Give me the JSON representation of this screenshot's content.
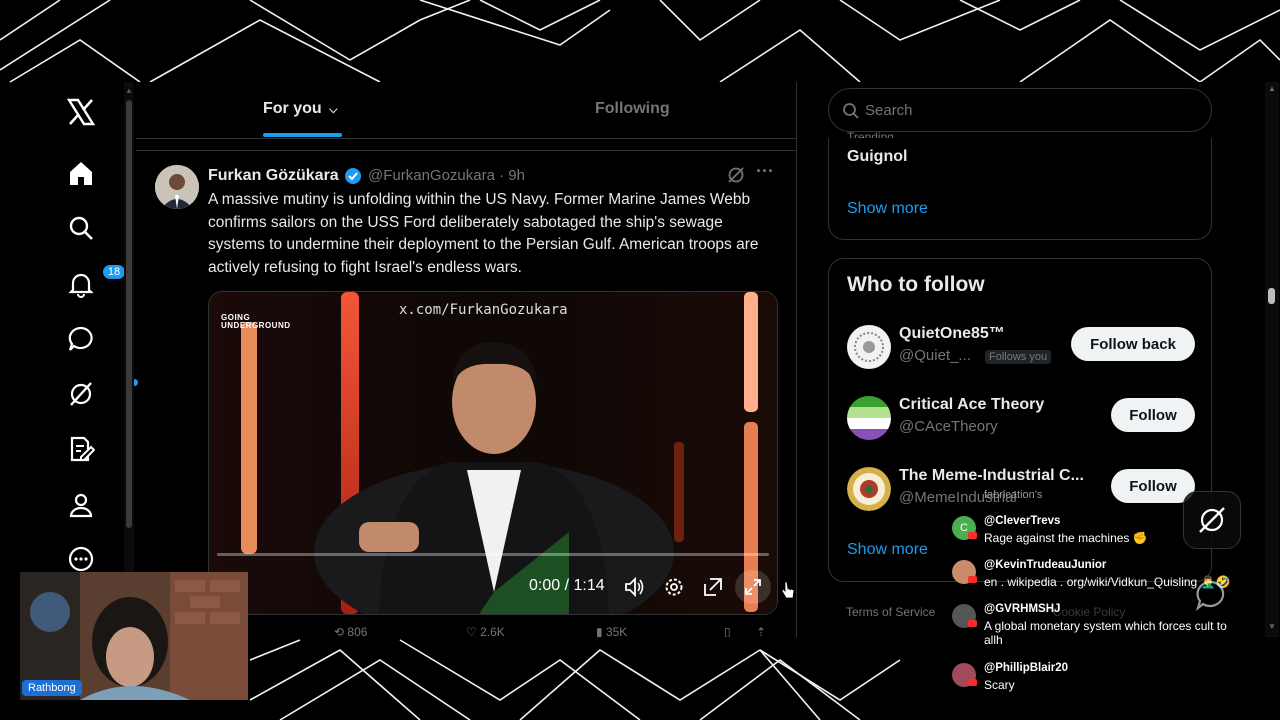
{
  "nav": {
    "notifications_count": "18",
    "icons": [
      "x-logo-icon",
      "home-icon",
      "search-icon",
      "bell-icon",
      "chat-icon",
      "grok-icon",
      "compose-icon",
      "profile-icon",
      "more-icon"
    ]
  },
  "feed": {
    "tabs": [
      {
        "label": "For you",
        "active": true
      },
      {
        "label": "Following",
        "active": false
      }
    ],
    "tweet": {
      "author": "Furkan Gözükara",
      "handle": "@FurkanGozukara · 9h",
      "text": "A massive mutiny is unfolding within the US Navy. Former Marine James Webb confirms sailors on the USS Ford deliberately sabotaged the ship's sewage systems to undermine their deployment to the Persian Gulf. American troops are actively refusing to fight Israel's endless wars.",
      "video": {
        "watermark": "x.com/FurkanGozukara",
        "show_logo_line1": "GOING",
        "show_logo_line2": "UNDERGROUND",
        "time": "0:00 / 1:14",
        "progress": 0
      },
      "stats": {
        "retweets": "806",
        "likes": "2.6K",
        "views": "35K"
      }
    }
  },
  "right": {
    "search_placeholder": "Search",
    "trend": {
      "label": "Trending",
      "title": "Guignol"
    },
    "show_more": "Show more",
    "who_to_follow": {
      "title": "Who to follow",
      "users": [
        {
          "name": "QuietOne85™",
          "handle": "@Quiet_...",
          "badge": "Follows you",
          "button": "Follow back"
        },
        {
          "name": "Critical Ace Theory",
          "handle": "@CAceTheory",
          "button": "Follow"
        },
        {
          "name": "The Meme-Industrial C...",
          "handle": "@MemeIndustrial",
          "button": "Follow"
        }
      ],
      "show_more": "Show more"
    },
    "footer": {
      "terms": "Terms of Service",
      "cookie": "Cookie Policy"
    }
  },
  "webcam": {
    "label": "Rathbong"
  },
  "chat": {
    "overlay_title": "fabrication's",
    "messages": [
      {
        "user": "@CleverTrevs",
        "text": "Rage against the machines ✊",
        "color": "#4caf50",
        "initial": "C"
      },
      {
        "user": "@KevinTrudeauJunior",
        "text": "en . wikipedia . org/wiki/Vidkun_Quisling 🤦‍♂️🤣",
        "color": "#c98b6b",
        "initial": ""
      },
      {
        "user": "@GVRHMSHJ",
        "text": "A global monetary system which forces cult to allh",
        "color": "#555",
        "initial": ""
      },
      {
        "user": "@PhillipBlair20",
        "text": "Scary",
        "color": "#a04b5a",
        "initial": ""
      }
    ]
  },
  "colors": {
    "accent": "#1d9bf0",
    "background": "#000000",
    "border": "#2f3336",
    "muted": "#71767b"
  }
}
